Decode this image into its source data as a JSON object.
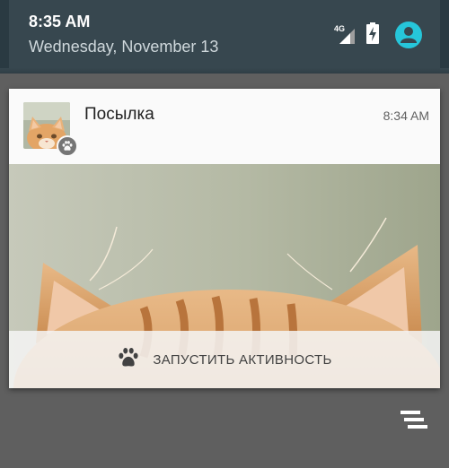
{
  "header": {
    "time": "8:35 AM",
    "date": "Wednesday, November 13",
    "network_type": "4G",
    "icons": [
      "signal-icon",
      "battery-charging-icon",
      "account-icon"
    ]
  },
  "notification": {
    "title": "Посылка",
    "time": "8:34 AM",
    "app_icon": "paw-icon",
    "action": {
      "icon": "paw-icon",
      "label": "ЗАПУСТИТЬ АКТИВНОСТЬ"
    }
  },
  "clear_all": {
    "icon": "clear-all-icon"
  },
  "colors": {
    "header_bg": "#37474f",
    "account_accent": "#26c6da",
    "shade_bg": "#5f5f5f",
    "card_bg": "#fafafa"
  }
}
